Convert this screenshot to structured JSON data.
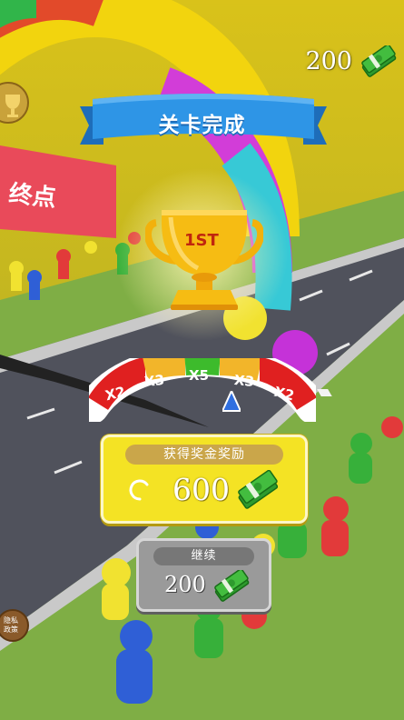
{
  "header": {
    "title": "关卡完成"
  },
  "scene": {
    "finish_sign": "终点"
  },
  "currency": {
    "amount": "200"
  },
  "trophy": {
    "rank": "1ST"
  },
  "multiplier": {
    "segments": [
      "X2",
      "X3",
      "X5",
      "X3",
      "X2"
    ]
  },
  "reward": {
    "label": "获得奖金奖励",
    "amount": "600"
  },
  "continue": {
    "label": "继续",
    "amount": "200"
  },
  "side_buttons": {
    "bottom_label": "隐私政策"
  },
  "colors": {
    "banner": "#2e95e6",
    "reward_panel": "#f4e324",
    "continue_panel": "#9a9a9a",
    "gauge_green": "#3dbb2c",
    "gauge_red": "#e02020"
  }
}
